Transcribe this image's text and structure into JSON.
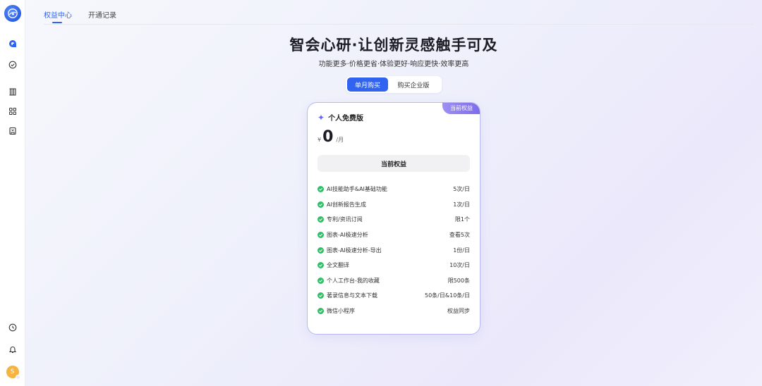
{
  "sidebar": {
    "items": [
      {
        "name": "chat-icon"
      },
      {
        "name": "check-shield-icon"
      },
      {
        "name": "library-icon"
      },
      {
        "name": "grid-icon"
      },
      {
        "name": "bookmark-icon"
      }
    ],
    "bottom": [
      {
        "name": "history-icon"
      },
      {
        "name": "bell-icon"
      }
    ],
    "avatar_letter": "S",
    "avatar_color": "#f5b342"
  },
  "tabs": [
    {
      "label": "权益中心",
      "active": true
    },
    {
      "label": "开通记录",
      "active": false
    }
  ],
  "hero": {
    "title": "智会心研·让创新灵感触手可及",
    "subtitle": "功能更多·价格更省·体验更好·响应更快·效率更高"
  },
  "toggle": {
    "options": [
      "单月购买",
      "购买企业版"
    ],
    "selected": "单月购买"
  },
  "card": {
    "badge": "当前权益",
    "plan_name": "个人免费版",
    "currency": "¥",
    "price": "0",
    "unit": "/月",
    "button_label": "当前权益",
    "features": [
      {
        "name": "AI技能助手&AI基础功能",
        "value": "5次/日"
      },
      {
        "name": "AI创新报告生成",
        "value": "1次/日"
      },
      {
        "name": "专利/资讯订阅",
        "value": "限1个"
      },
      {
        "name": "图表-AI极速分析",
        "value": "查看5次"
      },
      {
        "name": "图表-AI极速分析-导出",
        "value": "1份/日"
      },
      {
        "name": "全文翻译",
        "value": "10次/日"
      },
      {
        "name": "个人工作台-我的收藏",
        "value": "限500条"
      },
      {
        "name": "著录信息与文本下载",
        "value": "50条/日&10条/日"
      },
      {
        "name": "微信小程序",
        "value": "权益同步"
      }
    ]
  },
  "colors": {
    "accent": "#2f63f0",
    "badge": "#8b7cf0",
    "check": "#2fbf67",
    "card_border": "#b8b9f4"
  }
}
